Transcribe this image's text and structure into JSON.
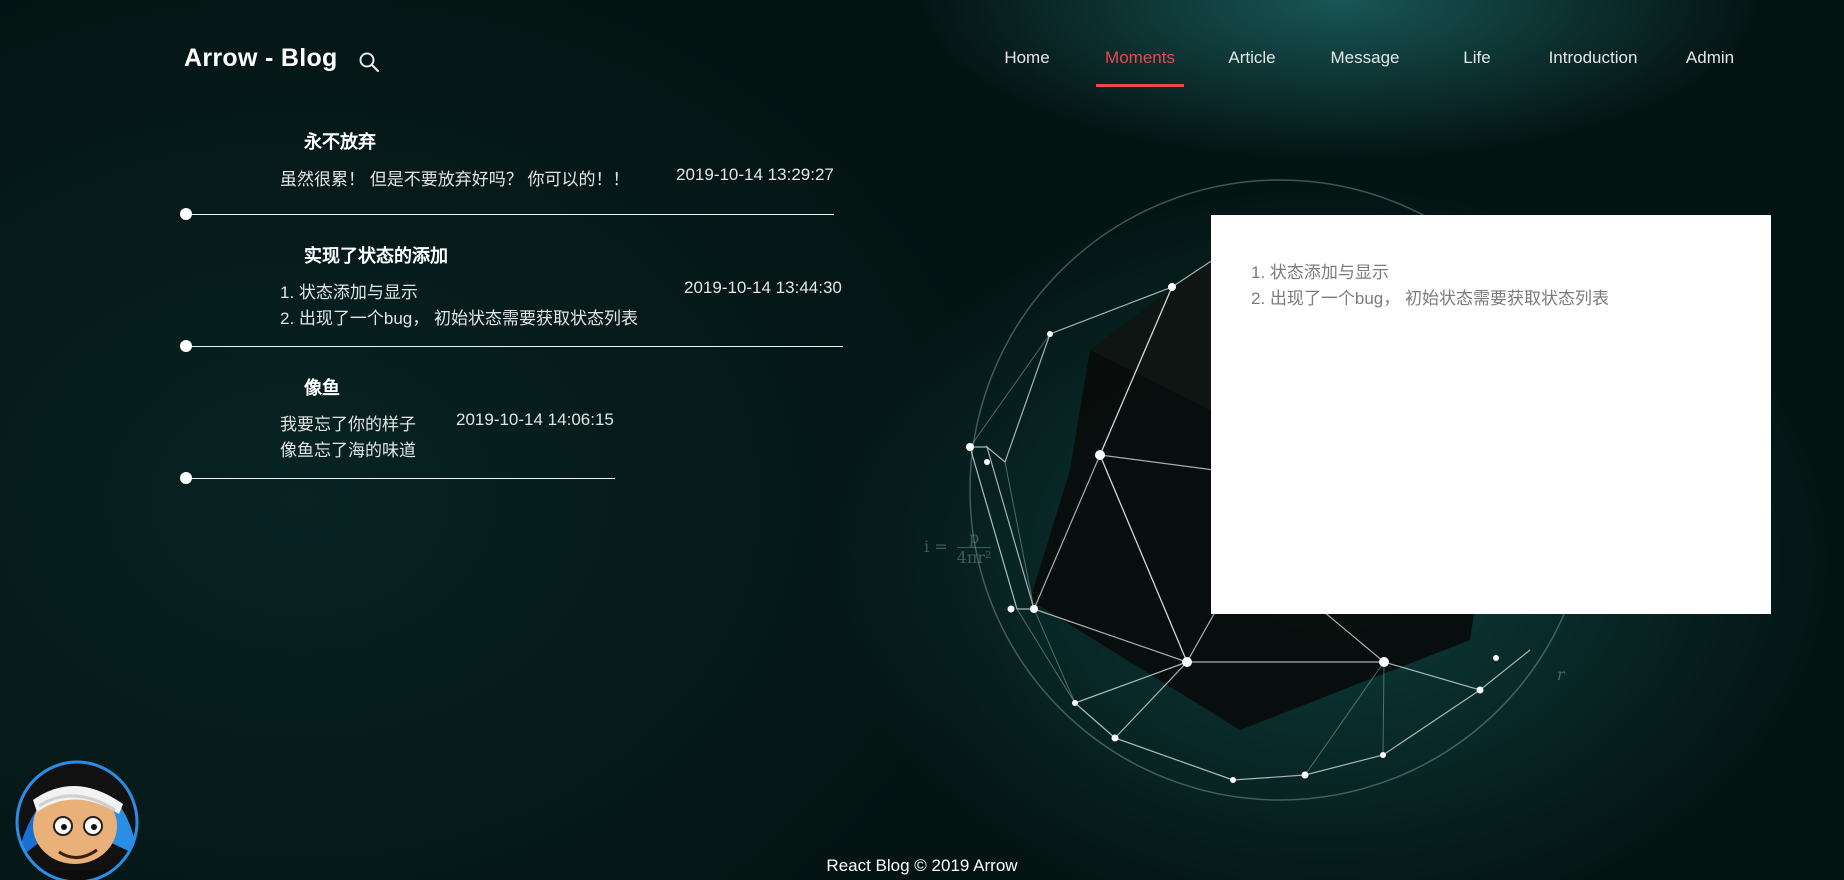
{
  "header": {
    "brand": "Arrow - Blog",
    "search_icon": "search-icon",
    "nav": [
      {
        "label": "Home",
        "active": false
      },
      {
        "label": "Moments",
        "active": true
      },
      {
        "label": "Article",
        "active": false
      },
      {
        "label": "Message",
        "active": false
      },
      {
        "label": "Life",
        "active": false
      },
      {
        "label": "Introduction",
        "active": false
      },
      {
        "label": "Admin",
        "active": false
      }
    ],
    "accent_color": "#e8484e"
  },
  "moments": [
    {
      "title": "永不放弃",
      "lines": [
        "虽然很累！ 但是不要放弃好吗？ 你可以的！！"
      ],
      "time": "2019-10-14 13:29:27"
    },
    {
      "title": "实现了状态的添加",
      "lines": [
        "1. 状态添加与显示",
        "2. 出现了一个bug， 初始状态需要获取状态列表"
      ],
      "time": "2019-10-14 13:44:30"
    },
    {
      "title": "像鱼",
      "lines": [
        "我要忘了你的样子",
        "像鱼忘了海的味道"
      ],
      "time": "2019-10-14 14:06:15"
    }
  ],
  "detail": {
    "lines": [
      "1. 状态添加与显示",
      "2. 出现了一个bug， 初始状态需要获取状态列表"
    ]
  },
  "background": {
    "formula_i": "i =",
    "formula_num": "p",
    "formula_den": "4πr²",
    "formula_r": "r"
  },
  "avatar_icon": "avatar-image",
  "footer": "React Blog © 2019 Arrow"
}
